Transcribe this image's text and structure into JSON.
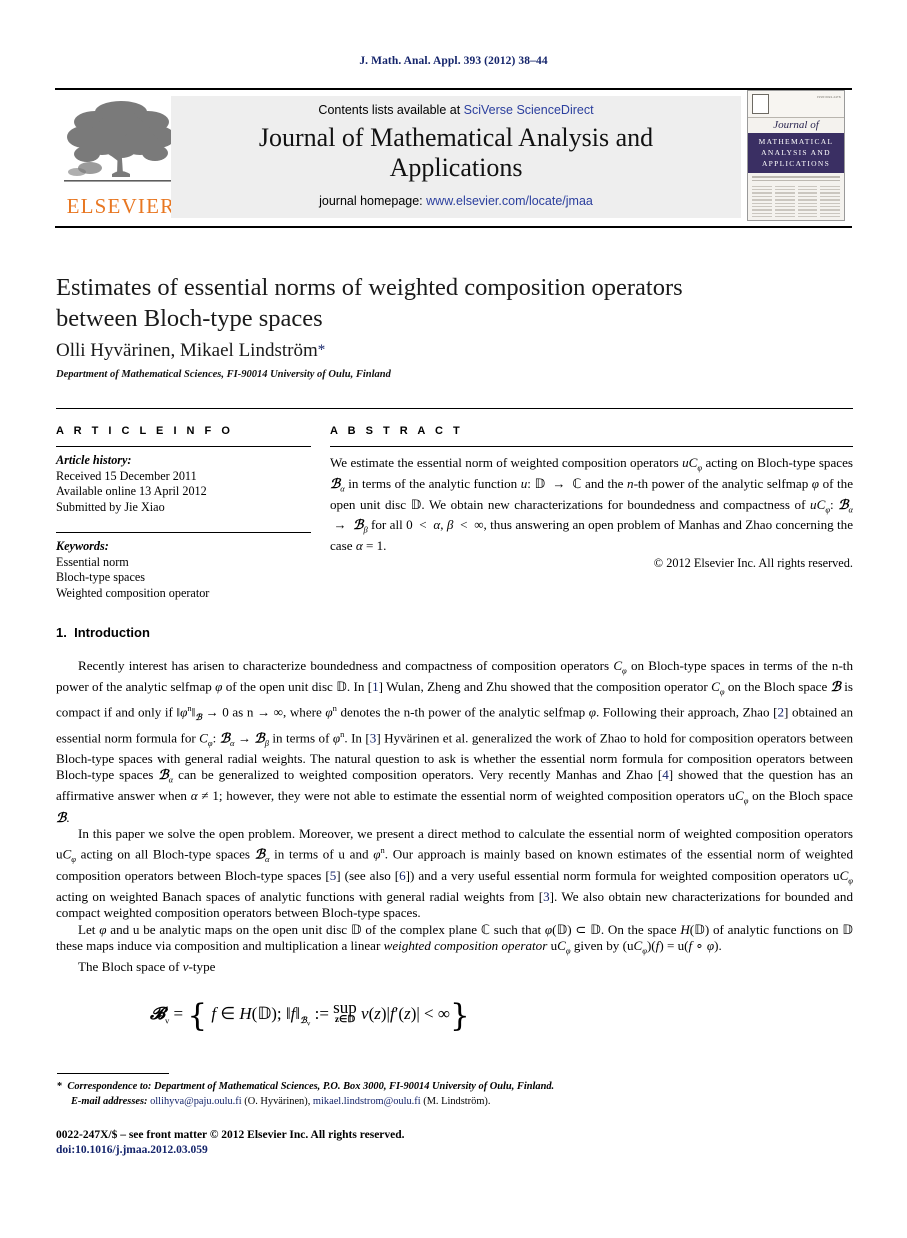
{
  "running_head": "J. Math. Anal. Appl. 393 (2012) 38–44",
  "masthead": {
    "contents_prefix": "Contents lists available at ",
    "sciencedirect": "SciVerse ScienceDirect",
    "journal_title_line1": "Journal of Mathematical Analysis and",
    "journal_title_line2": "Applications",
    "homepage_prefix": "journal homepage: ",
    "homepage_url": "www.elsevier.com/locate/jmaa",
    "publisher_logo_word": "ELSEVIER",
    "cover": {
      "script_word": "Journal of",
      "band_line1": "MATHEMATICAL",
      "band_line2": "ANALYSIS AND",
      "band_line3": "APPLICATIONS",
      "corner_text": "ISSN 0022-247X"
    }
  },
  "article": {
    "title_line1": "Estimates of essential norms of weighted composition operators",
    "title_line2": "between Bloch-type spaces",
    "authors": "Olli Hyvärinen, Mikael Lindström",
    "author_marker": "*",
    "affiliation": "Department of Mathematical Sciences, FI-90014 University of Oulu, Finland"
  },
  "article_info": {
    "heading": "A R T I C L E   I N F O",
    "history_label": "Article history:",
    "history": [
      "Received 15 December 2011",
      "Available online 13 April 2012",
      "Submitted by Jie Xiao"
    ],
    "keywords_label": "Keywords:",
    "keywords": [
      "Essential norm",
      "Bloch-type spaces",
      "Weighted composition operator"
    ]
  },
  "abstract": {
    "heading": "A B S T R A C T",
    "text": "We estimate the essential norm of weighted composition operators uC𝜑 acting on Bloch-type spaces 𝓑α in terms of the analytic function u: 𝔻 → ℂ and the n-th power of the analytic selfmap 𝜑 of the open unit disc 𝔻. We obtain new characterizations for boundedness and compactness of uC𝜑: 𝓑α → 𝓑β for all 0 < α, β < ∞, thus answering an open problem of Manhas and Zhao concerning the case α = 1.",
    "copyright": "© 2012 Elsevier Inc. All rights reserved."
  },
  "section": {
    "number": "1.",
    "heading": "Introduction"
  },
  "body": {
    "p1": "Recently interest has arisen to characterize boundedness and compactness of composition operators C𝜑 on Bloch-type spaces in terms of the n-th power of the analytic selfmap 𝜑 of the open unit disc 𝔻. In [1] Wulan, Zheng and Zhu showed that the composition operator C𝜑 on the Bloch space 𝓑 is compact if and only if ‖𝜑ⁿ‖𝓑 → 0 as n → ∞, where 𝜑ⁿ denotes the n-th power of the analytic selfmap 𝜑. Following their approach, Zhao [2] obtained an essential norm formula for C𝜑: 𝓑α → 𝓑β in terms of 𝜑ⁿ. In [3] Hyvärinen et al. generalized the work of Zhao to hold for composition operators between Bloch-type spaces with general radial weights. The natural question to ask is whether the essential norm formula for composition operators between Bloch-type spaces 𝓑α can be generalized to weighted composition operators. Very recently Manhas and Zhao [4] showed that the question has an affirmative answer when α ≠ 1; however, they were not able to estimate the essential norm of weighted composition operators uC𝜑 on the Bloch space 𝓑.",
    "p2": "In this paper we solve the open problem. Moreover, we present a direct method to calculate the essential norm of weighted composition operators uC𝜑 acting on all Bloch-type spaces 𝓑α in terms of u and 𝜑ⁿ. Our approach is mainly based on known estimates of the essential norm of weighted composition operators between Bloch-type spaces [5] (see also [6]) and a very useful essential norm formula for weighted composition operators uC𝜑 acting on weighted Banach spaces of analytic functions with general radial weights from [3]. We also obtain new characterizations for bounded and compact weighted composition operators between Bloch-type spaces.",
    "p3": "Let 𝜑 and u be analytic maps on the open unit disc 𝔻 of the complex plane ℂ such that 𝜑(𝔻) ⊂ 𝔻. On the space H(𝔻) of analytic functions on 𝔻 these maps induce via composition and multiplication a linear weighted composition operator uC𝜑 given by (uC𝜑)(f) = u(f ∘ 𝜑).",
    "p4": "The Bloch space of v-type"
  },
  "equation": {
    "lhs": "𝓑",
    "lhs_sub": "v",
    "eq": "=",
    "open_brace": "{",
    "part1": "f ∈ H(𝔻); ‖f‖",
    "part1_sub": "𝓑ᵥ",
    "part2": ":=",
    "sup_top": "sup",
    "sup_bot": "z∈𝔻",
    "part3": "v(z)|f′(z)| < ∞",
    "close_brace": "}"
  },
  "footnotes": {
    "star": "*",
    "correspondence": "Correspondence to: Department of Mathematical Sciences, P.O. Box 3000, FI-90014 University of Oulu, Finland.",
    "email_label": "E-mail addresses:",
    "email1": "ollihyva@paju.oulu.fi",
    "email1_name": "(O. Hyvärinen),",
    "email2": "mikael.lindstrom@oulu.fi",
    "email2_name": "(M. Lindström)."
  },
  "imprint": {
    "issn_line": "0022-247X/$ – see front matter © 2012 Elsevier Inc. All rights reserved.",
    "doi_line": "doi:10.1016/j.jmaa.2012.03.059"
  },
  "colors": {
    "link": "#14246b",
    "sciencedirect": "#2b3f9e",
    "elsevier_orange": "#e87722",
    "cover_band": "#3a2f63",
    "banner_bg": "#eeeeee"
  }
}
